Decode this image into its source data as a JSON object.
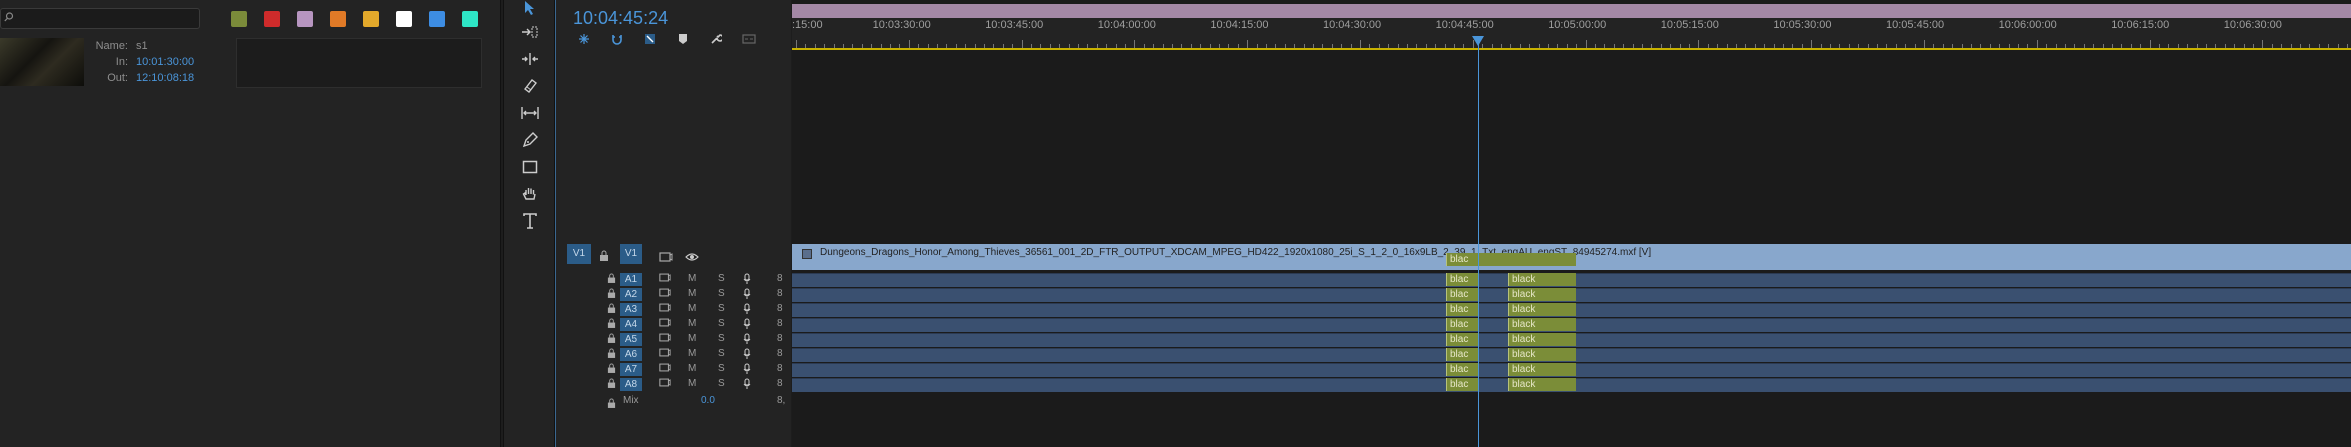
{
  "project": {
    "search": {
      "value": "",
      "placeholder": ""
    },
    "swatches": [
      "#7b8b3a",
      "#cf2b2b",
      "#b795c0",
      "#e07a27",
      "#e3a92b",
      "#ffffff",
      "#3d8de3",
      "#2ee6c6"
    ],
    "clip_info": {
      "name_label": "Name:",
      "name_value": "s1",
      "in_label": "In:",
      "in_value": "10:01:30:00",
      "out_label": "Out:",
      "out_value": "12:10:08:18"
    }
  },
  "tools": [
    "selection-tool",
    "track-select-tool",
    "ripple-edit-tool",
    "razor-tool",
    "slip-tool",
    "pen-tool",
    "rectangle-tool",
    "hand-tool",
    "type-tool"
  ],
  "timeline": {
    "timecode": "10:04:45:24",
    "ruler_labels": [
      ":15:00",
      "10:03:30:00",
      "10:03:45:00",
      "10:04:00:00",
      "10:04:15:00",
      "10:04:30:00",
      "10:04:45:00",
      "10:05:00:00",
      "10:05:15:00",
      "10:05:30:00",
      "10:05:45:00",
      "10:06:00:00",
      "10:06:15:00",
      "10:06:30:00"
    ],
    "video_track": {
      "source_label": "V1",
      "target_label": "V1"
    },
    "video_clip_name": "Dungeons_Dragons_Honor_Among_Thieves_36561_001_2D_FTR_OUTPUT_XDCAM_MPEG_HD422_1920x1080_25i_S_1_2_0_16x9LB_2_39_1_Txt_engAU_engST_84945274.mxf [V]",
    "audio_tracks": [
      "A1",
      "A2",
      "A3",
      "A4",
      "A5",
      "A6",
      "A7",
      "A8"
    ],
    "track_buttons": {
      "mute": "M",
      "solo": "S",
      "volume": "8"
    },
    "mix": {
      "label": "Mix",
      "value": "0.0",
      "end": "8,"
    },
    "black_short": "blac",
    "black_full": "black"
  }
}
